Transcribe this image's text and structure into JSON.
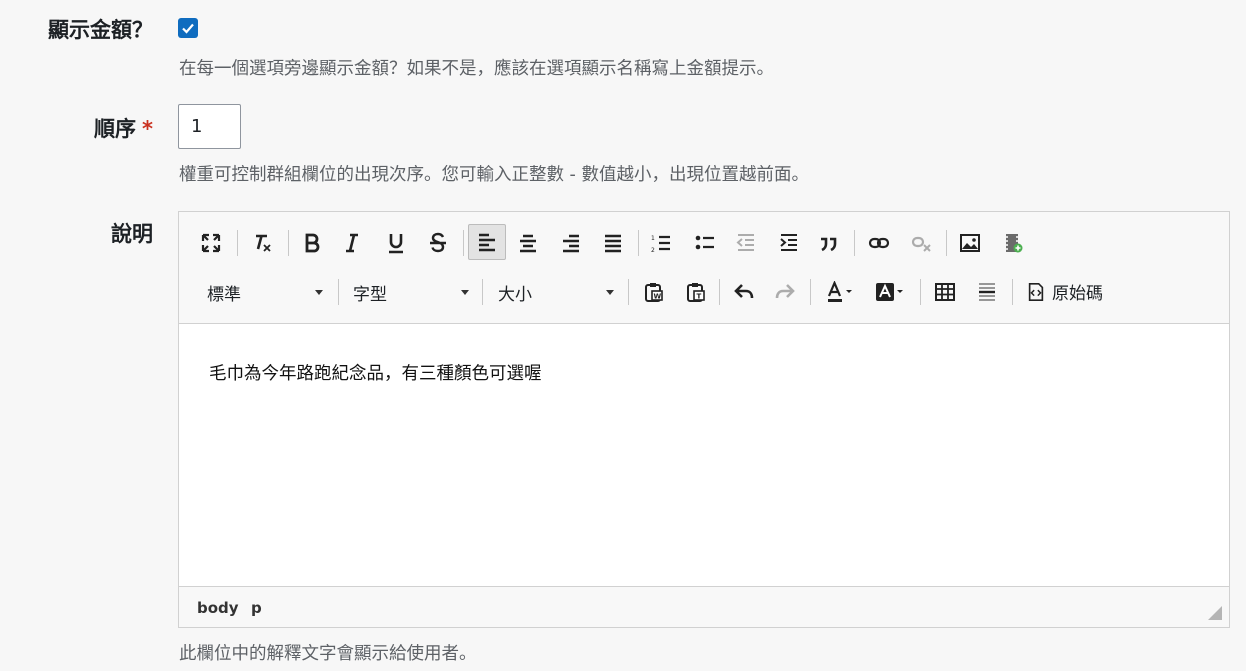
{
  "fields": {
    "show_amount": {
      "label": "顯示金額？",
      "checked": true,
      "help": "在每一個選項旁邊顯示金額？如果不是，應該在選項顯示名稱寫上金額提示。"
    },
    "order": {
      "label": "順序",
      "required_mark": "*",
      "value": "1",
      "help": "權重可控制群組欄位的出現次序。您可輸入正整數 - 數值越小，出現位置越前面。"
    },
    "description": {
      "label": "說明",
      "help": "此欄位中的解釋文字會顯示給使用者。"
    }
  },
  "editor": {
    "combos": {
      "format": "標準",
      "font": "字型",
      "size": "大小"
    },
    "source_label": "原始碼",
    "content": "毛巾為今年路跑紀念品，有三種顏色可選喔",
    "path": [
      "body",
      "p"
    ],
    "icons_row1": [
      "maximize-icon",
      "remove-format-icon",
      "bold-icon",
      "italic-icon",
      "underline-icon",
      "strikethrough-icon",
      "align-left-icon",
      "align-center-icon",
      "align-right-icon",
      "justify-icon",
      "numbered-list-icon",
      "bulleted-list-icon",
      "outdent-icon",
      "indent-icon",
      "blockquote-icon",
      "link-icon",
      "unlink-icon",
      "image-icon",
      "video-icon"
    ],
    "icons_row2": [
      "paste-word-icon",
      "paste-text-icon",
      "undo-icon",
      "redo-icon",
      "text-color-icon",
      "background-color-icon",
      "table-icon",
      "horizontal-rule-icon",
      "source-icon"
    ],
    "accent_color": "#0f6cbf",
    "required_color": "#ca3120"
  }
}
